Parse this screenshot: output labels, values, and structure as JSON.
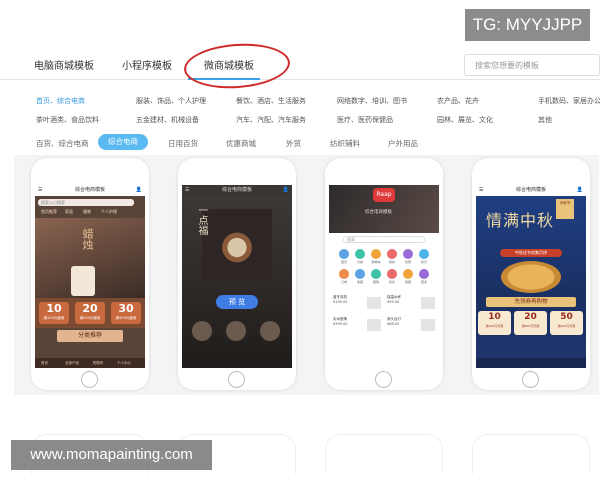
{
  "watermark": "TG: MYYJJPP",
  "footer_watermark": "www.momapainting.com",
  "tabs": [
    "电脑商城模板",
    "小程序模板",
    "微商城模板"
  ],
  "search": {
    "placeholder": "搜索您想要的模板"
  },
  "categories": [
    "首页、综合电商",
    "服装、饰品、个人护理",
    "餐饮、酒店、生活服务",
    "网络数字、培训、图书",
    "农产品、花卉",
    "手机数码、家居办公",
    "茶叶酒类、食品饮料",
    "五金建材、机械设备",
    "汽车、汽配、汽车服务",
    "医疗、医药保健品",
    "园林、展览、文化",
    "其他"
  ],
  "filters": [
    "百货、综合电商",
    "综合电商",
    "日用百货",
    "优惠商城",
    "外贸",
    "纺织辅料",
    "户外用品"
  ],
  "colors": {
    "accent": "#3aa0e8",
    "highlight_circle": "#cf2a2a",
    "pill": "#5bb9f2"
  },
  "cards": [
    {
      "title": "综合电商模板",
      "search": "搜索入口搜索",
      "nav": [
        "首页推荐",
        "家居",
        "服装",
        "个人护理"
      ],
      "hero_text": "蜡烛",
      "coupons": [
        {
          "value": "10",
          "label": "满100元使用"
        },
        {
          "value": "20",
          "label": "满200元使用"
        },
        {
          "value": "30",
          "label": "满300元使用"
        }
      ],
      "banner": "分类推荐",
      "tabbar": [
        "首页",
        "全部产品",
        "购物车",
        "个人中心"
      ]
    },
    {
      "title": "综合电商模板",
      "hero_text": "一点福",
      "button": "预 览"
    },
    {
      "logo": "Raap",
      "subtitle": "综合电商模板",
      "search": "搜索",
      "icons": [
        "首页",
        "分类",
        "购物车",
        "我的",
        "优惠",
        "积分",
        "订单",
        "收藏",
        "团购",
        "秒杀",
        "客服",
        "更多"
      ],
      "list": [
        {
          "title": "蓝牙耳机",
          "sub": "¥199.00"
        },
        {
          "title": "保温水杯",
          "sub": "¥59.00"
        },
        {
          "title": "实木座椅",
          "sub": "¥399.00"
        },
        {
          "title": "床头台灯",
          "sub": "¥88.00"
        }
      ]
    },
    {
      "title": "综合电商模板",
      "hero_text": "情满中秋",
      "tag": "中秋节",
      "sub": "中秋佳节欢聚月饼",
      "banner": "先领券再购物",
      "coupons": [
        {
          "value": "10",
          "label": "满100元可用"
        },
        {
          "value": "20",
          "label": "满200元可用"
        },
        {
          "value": "50",
          "label": "满500元可用"
        }
      ]
    }
  ]
}
